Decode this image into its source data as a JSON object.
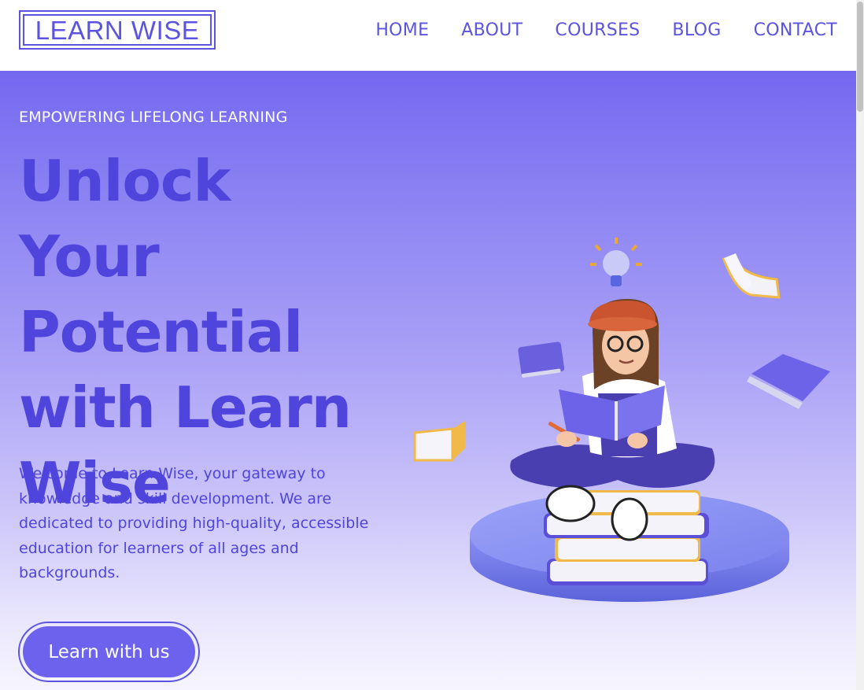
{
  "brand": {
    "logo_text": "LEARN WISE"
  },
  "nav": {
    "items": [
      {
        "label": "HOME"
      },
      {
        "label": "ABOUT"
      },
      {
        "label": "COURSES"
      },
      {
        "label": "BLOG"
      },
      {
        "label": "CONTACT"
      }
    ]
  },
  "hero": {
    "eyebrow": "EMPOWERING LIFELONG LEARNING",
    "headline_lines": [
      "Unlock Your",
      "Potential",
      "with Learn",
      "Wise"
    ],
    "intro": "Welcome to Learn Wise, your gateway to knowledge and skill development. We are dedicated to providing high-quality, accessible education for learners of all ages and backgrounds.",
    "cta_label": "Learn with us"
  },
  "colors": {
    "brand": "#5b54e0",
    "headline": "#4f45dd",
    "button": "#6c62ee",
    "gradient_top": "#7468f0",
    "gradient_bottom": "#f6f5fe"
  },
  "icons": [
    "lightbulb-icon",
    "book-icon"
  ]
}
